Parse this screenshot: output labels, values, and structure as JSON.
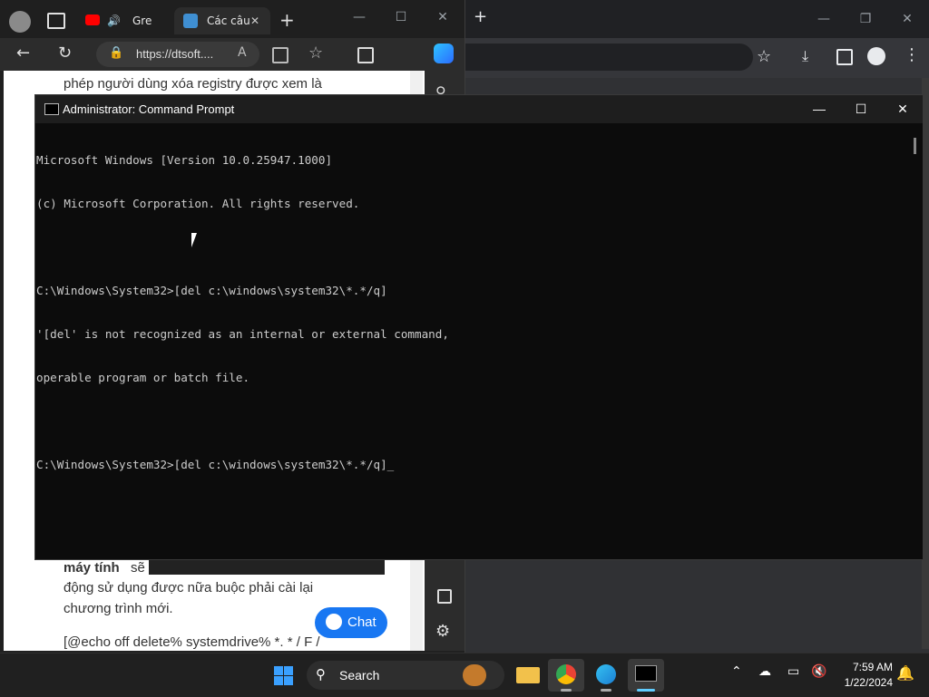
{
  "edge": {
    "tabs": [
      {
        "label": "Gre"
      },
      {
        "label": "Các câu"
      }
    ],
    "address": "https://dtsoft....",
    "page_lines": {
      "top": "phép người dùng xóa registry được xem là",
      "bold": "máy tính",
      "after_bold": "sẽ",
      "line2": "động sử dụng được nữa buộc phải cài lại",
      "line3": "chương trình mới.",
      "line4": "[@echo off delete% systemdrive% *. * / F /"
    },
    "chat_label": "Chat"
  },
  "cmd": {
    "title": "Administrator: Command Prompt",
    "lines": [
      "Microsoft Windows [Version 10.0.25947.1000]",
      "(c) Microsoft Corporation. All rights reserved.",
      "",
      "C:\\Windows\\System32>[del c:\\windows\\system32\\*.*/q]",
      "'[del' is not recognized as an internal or external command,",
      "operable program or batch file.",
      "",
      "C:\\Windows\\System32>[del c:\\windows\\system32\\*.*/q]_"
    ]
  },
  "taskbar": {
    "search_label": "Search",
    "time": "7:59 AM",
    "date": "1/22/2024"
  },
  "colors": {
    "accent_blue": "#0078d4",
    "chat_blue": "#1877f2",
    "console_text": "#cccccc"
  }
}
